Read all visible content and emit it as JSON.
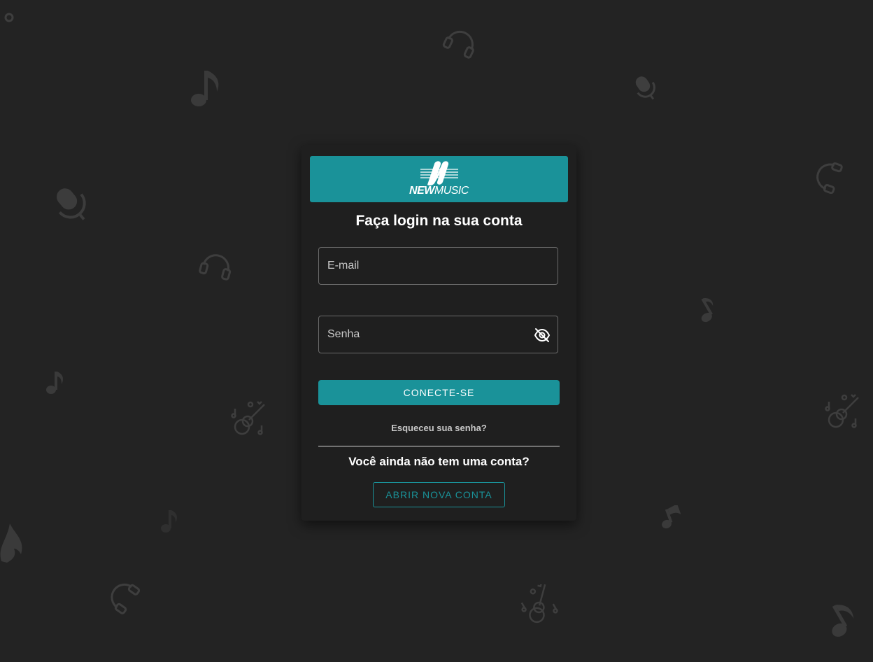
{
  "brand": {
    "name_bold": "NEW",
    "name_light": "MUSIC",
    "banner_color": "#1a9299"
  },
  "login": {
    "title": "Faça login na sua conta",
    "email_placeholder": "E-mail",
    "password_placeholder": "Senha",
    "password_toggle_icon": "eye-off-icon",
    "submit_label": "CONECTE-SE",
    "forgot_password": "Esqueceu sua senha?",
    "no_account_text": "Você ainda não tem uma conta?",
    "signup_label": "ABRIR NOVA CONTA"
  },
  "colors": {
    "background": "#232323",
    "card": "#1f1f1f",
    "accent": "#1a9299"
  },
  "background_icons": [
    "headphones-icon",
    "music-note-icon",
    "microphone-icon",
    "guitar-icon",
    "eighth-note-icon"
  ]
}
